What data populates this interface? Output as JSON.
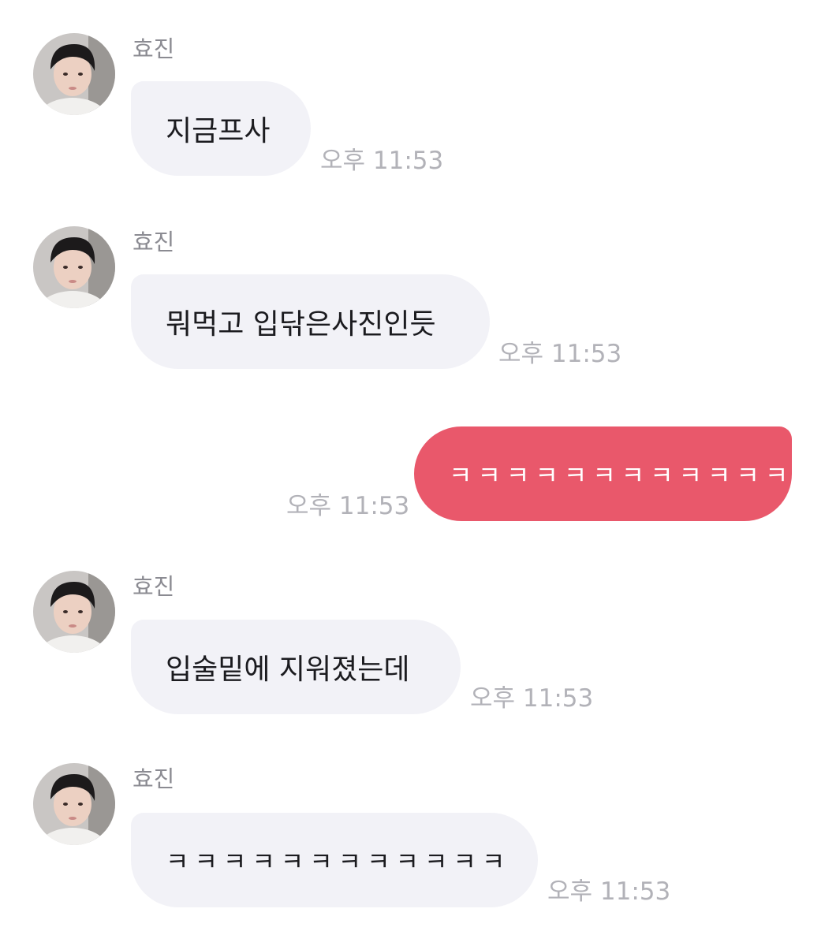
{
  "chat": {
    "contact_name": "효진",
    "colors": {
      "incoming_bubble": "#f2f2f7",
      "outgoing_bubble": "#e9586b",
      "timestamp": "#b2b2b8",
      "name": "#8b8b92"
    },
    "messages": [
      {
        "direction": "incoming",
        "sender": "효진",
        "text": "지금프사",
        "time": "오후 11:53"
      },
      {
        "direction": "incoming",
        "sender": "효진",
        "text": "뭐먹고 입닦은사진인듯",
        "time": "오후 11:53"
      },
      {
        "direction": "outgoing",
        "text": "ㅋㅋㅋㅋㅋㅋㅋㅋㅋㅋㅋㅋㅋ",
        "time": "오후 11:53"
      },
      {
        "direction": "incoming",
        "sender": "효진",
        "text": "입술밑에 지워졌는데",
        "time": "오후 11:53"
      },
      {
        "direction": "incoming",
        "sender": "효진",
        "text": "ㅋㅋㅋㅋㅋㅋㅋㅋㅋㅋㅋㅋ",
        "time": "오후 11:53"
      }
    ]
  }
}
